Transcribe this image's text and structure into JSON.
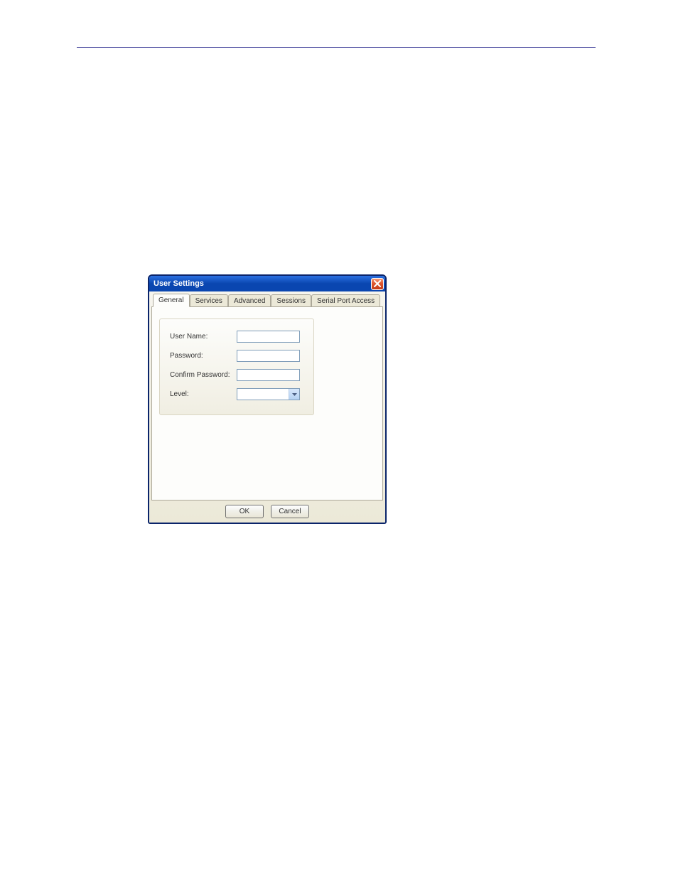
{
  "dialog": {
    "title": "User Settings",
    "tabs": {
      "general": "General",
      "services": "Services",
      "advanced": "Advanced",
      "sessions": "Sessions",
      "serial_port_access": "Serial Port Access"
    },
    "form": {
      "user_name_label": "User Name:",
      "user_name_value": "",
      "password_label": "Password:",
      "password_value": "",
      "confirm_password_label": "Confirm Password:",
      "confirm_password_value": "",
      "level_label": "Level:",
      "level_value": ""
    },
    "buttons": {
      "ok": "OK",
      "cancel": "Cancel"
    }
  }
}
